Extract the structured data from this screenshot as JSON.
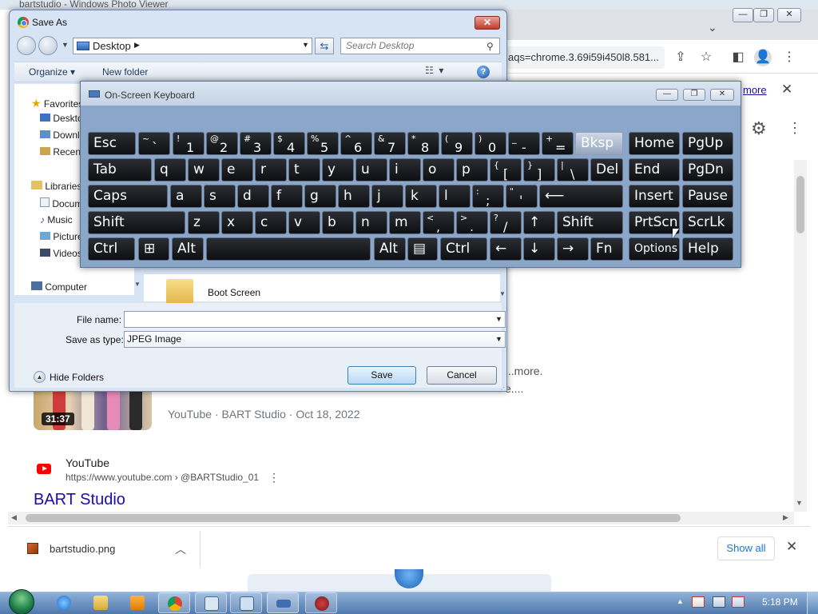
{
  "chrome": {
    "title": "bartstudio - Windows Photo Viewer",
    "omnibox": "aqs=chrome.3.69i59i450l8.581...",
    "more_link": "more",
    "result_more": "...more.",
    "result_ellipsis": "e....",
    "video": {
      "duration": "31:37",
      "meta": "YouTube · BART Studio · Oct 18, 2022"
    },
    "result": {
      "site": "YouTube",
      "url": "https://www.youtube.com › @BARTStudio_01",
      "title": "BART Studio"
    },
    "download": {
      "file_name": "bartstudio.png",
      "show_all": "Show all"
    }
  },
  "save_as": {
    "title": "Save As",
    "address": "Desktop",
    "search_placeholder": "Search Desktop",
    "organize": "Organize",
    "new_folder": "New folder",
    "nav": {
      "favorites": "Favorites",
      "desktop": "Desktop",
      "downloads": "Downloads",
      "recent": "Recent Places",
      "libraries": "Libraries",
      "documents": "Documents",
      "music": "Music",
      "pictures": "Pictures",
      "videos": "Videos",
      "computer": "Computer"
    },
    "folder_name": "Boot Screen",
    "file_name_label": "File name:",
    "file_name_value": "",
    "save_type_label": "Save as type:",
    "save_type_value": "JPEG Image",
    "hide_folders": "Hide Folders",
    "save_button": "Save",
    "cancel_button": "Cancel"
  },
  "osk": {
    "title": "On-Screen Keyboard",
    "keys": {
      "esc": "Esc",
      "tilde_hi": "~",
      "tilde_lo": "`",
      "k1_hi": "!",
      "k1_lo": "1",
      "k2_hi": "@",
      "k2_lo": "2",
      "k3_hi": "#",
      "k3_lo": "3",
      "k4_hi": "$",
      "k4_lo": "4",
      "k5_hi": "%",
      "k5_lo": "5",
      "k6_hi": "^",
      "k6_lo": "6",
      "k7_hi": "&",
      "k7_lo": "7",
      "k8_hi": "*",
      "k8_lo": "8",
      "k9_hi": "(",
      "k9_lo": "9",
      "k0_hi": ")",
      "k0_lo": "0",
      "minus_hi": "_",
      "minus_lo": "-",
      "eq_hi": "+",
      "eq_lo": "=",
      "bksp": "Bksp",
      "home": "Home",
      "pgup": "PgUp",
      "tab": "Tab",
      "q": "q",
      "w": "w",
      "e": "e",
      "r": "r",
      "t": "t",
      "y": "y",
      "u": "u",
      "i": "i",
      "o": "o",
      "p": "p",
      "lbr_hi": "{",
      "lbr_lo": "[",
      "rbr_hi": "}",
      "rbr_lo": "]",
      "bsl_hi": "|",
      "bsl_lo": "\\",
      "del": "Del",
      "end": "End",
      "pgdn": "PgDn",
      "caps": "Caps",
      "a": "a",
      "s": "s",
      "d": "d",
      "f": "f",
      "g": "g",
      "h": "h",
      "j": "j",
      "k": "k",
      "l": "l",
      "semi_hi": ":",
      "semi_lo": ";",
      "quote_hi": "\"",
      "quote_lo": "'",
      "enter": "⟵",
      "insert": "Insert",
      "pause": "Pause",
      "shift": "Shift",
      "z": "z",
      "x": "x",
      "c": "c",
      "v": "v",
      "b": "b",
      "n": "n",
      "m": "m",
      "comma_hi": "<",
      "comma_lo": ",",
      "period_hi": ">",
      "period_lo": ".",
      "slash_hi": "?",
      "slash_lo": "/",
      "up": "↑",
      "shift_r": "Shift",
      "prtscn": "PrtScn",
      "scrlk": "ScrLk",
      "ctrl": "Ctrl",
      "win": "⊞",
      "alt": "Alt",
      "alt_r": "Alt",
      "menu": "▤",
      "ctrl_r": "Ctrl",
      "left": "←",
      "down": "↓",
      "right": "→",
      "fn": "Fn",
      "options": "Options",
      "help": "Help"
    }
  },
  "taskbar": {
    "clock": "5:18 PM"
  }
}
